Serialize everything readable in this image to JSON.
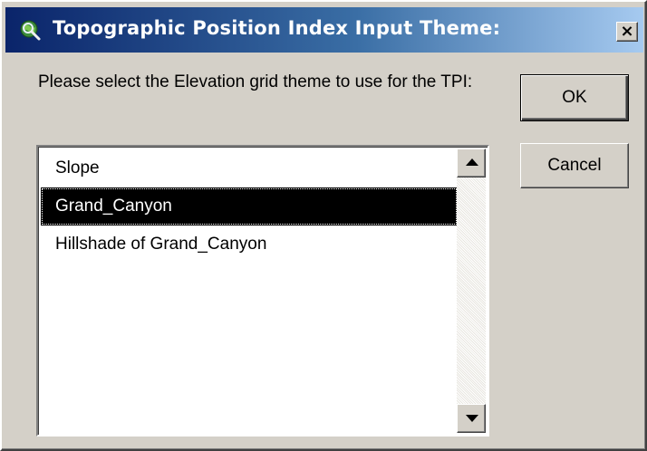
{
  "window": {
    "title": "Topographic Position Index Input Theme:",
    "close_label": "×",
    "icon": "globe-magnifier-icon"
  },
  "dialog": {
    "prompt": "Please select the Elevation grid theme to use for the TPI:"
  },
  "list": {
    "items": [
      {
        "label": "Slope",
        "selected": false
      },
      {
        "label": "Grand_Canyon",
        "selected": true
      },
      {
        "label": "Hillshade of Grand_Canyon",
        "selected": false
      }
    ]
  },
  "buttons": {
    "ok_label": "OK",
    "cancel_label": "Cancel"
  },
  "colors": {
    "titlebar_start": "#0a246a",
    "titlebar_end": "#a6caf0",
    "face": "#d4d0c8",
    "selection": "#000000"
  }
}
